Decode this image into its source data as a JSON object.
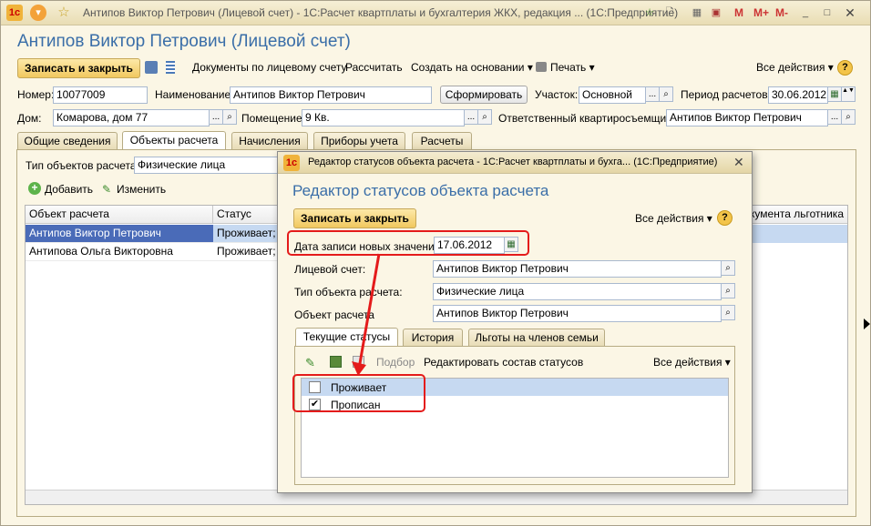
{
  "window": {
    "title": "Антипов Виктор Петрович (Лицевой счет) - 1С:Расчет квартплаты и бухгалтерия ЖКХ, редакция ... (1С:Предприятие)",
    "right_icons": [
      "M",
      "M+",
      "M-"
    ]
  },
  "form": {
    "title": "Антипов Виктор Петрович (Лицевой счет)",
    "toolbar": {
      "save_close": "Записать и закрыть",
      "docs": "Документы по лицевому счету",
      "calculate": "Рассчитать",
      "create_based": "Создать на основании",
      "print": "Печать",
      "all_actions": "Все действия"
    },
    "fields": {
      "number_label": "Номер:",
      "number_value": "10077009",
      "name_label": "Наименование:",
      "name_value": "Антипов Виктор Петрович",
      "form_button": "Сформировать",
      "section_label": "Участок:",
      "section_value": "Основной",
      "period_label": "Период расчетов:",
      "period_value": "30.06.2012",
      "house_label": "Дом:",
      "house_value": "Комарова, дом 77",
      "room_label": "Помещение:",
      "room_value": "9 Кв.",
      "tenant_label": "Ответственный квартиросъемщик:",
      "tenant_value": "Антипов Виктор Петрович"
    },
    "tabs": [
      "Общие сведения",
      "Объекты расчета",
      "Начисления",
      "Приборы учета",
      "Расчеты"
    ],
    "objects": {
      "type_label": "Тип объектов расчета:",
      "type_value": "Физические лица",
      "add": "Добавить",
      "edit": "Изменить",
      "col_object": "Объект расчета",
      "col_status": "Статус",
      "col_doc": "окумента льготника",
      "rows": [
        {
          "object": "Антипов Виктор Петрович",
          "status": "Проживает; П"
        },
        {
          "object": "Антипова Ольга Викторовна",
          "status": "Проживает; П"
        }
      ]
    }
  },
  "dialog": {
    "title": "Редактор статусов объекта расчета - 1С:Расчет квартплаты и бухга... (1С:Предприятие)",
    "heading": "Редактор статусов объекта расчета",
    "save_close": "Записать и закрыть",
    "all_actions": "Все действия",
    "date_label": "Дата записи новых значений:",
    "date_value": "17.06.2012",
    "account_label": "Лицевой счет:",
    "account_value": "Антипов Виктор Петрович",
    "type_label": "Тип объекта расчета:",
    "type_value": "Физические лица",
    "object_label": "Объект расчета",
    "object_value": "Антипов Виктор Петрович",
    "tabs": [
      "Текущие статусы",
      "История",
      "Льготы на членов семьи"
    ],
    "list_toolbar": {
      "select": "Подбор",
      "edit_composition": "Редактировать состав статусов",
      "all_actions": "Все действия"
    },
    "statuses": [
      {
        "name": "Проживает",
        "checked": false
      },
      {
        "name": "Прописан",
        "checked": true
      }
    ]
  },
  "colors": {
    "accent_title": "#3a6ea8",
    "highlight": "#e41b1b",
    "selected_row": "#c6d9f1"
  }
}
